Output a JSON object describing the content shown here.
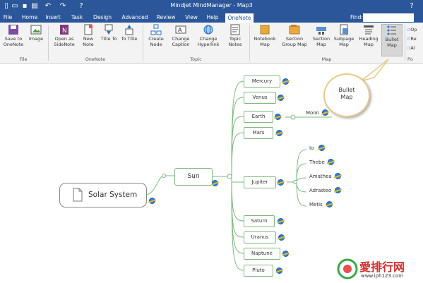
{
  "window": {
    "title": "Mindjet MindManager - Map3"
  },
  "quick_access": [
    "new-icon",
    "open-icon",
    "save-icon",
    "print-icon",
    "undo-icon",
    "redo-icon",
    "help-icon"
  ],
  "tabs": [
    {
      "label": "File"
    },
    {
      "label": "Home"
    },
    {
      "label": "Insert"
    },
    {
      "label": "Task"
    },
    {
      "label": "Design"
    },
    {
      "label": "Advanced"
    },
    {
      "label": "Review"
    },
    {
      "label": "View"
    },
    {
      "label": "Help"
    },
    {
      "label": "OneNote",
      "active": true
    }
  ],
  "find": {
    "label": "Find:",
    "value": ""
  },
  "ribbon": {
    "groups": [
      {
        "label": "File",
        "buttons": [
          {
            "label": "Save to OneNote"
          },
          {
            "label": "Image"
          }
        ]
      },
      {
        "label": "OneNote",
        "buttons": [
          {
            "label": "Open as SideNote"
          },
          {
            "label": "New Note"
          },
          {
            "label": "Title To"
          },
          {
            "label": "To Title"
          }
        ]
      },
      {
        "label": "Topic",
        "buttons": [
          {
            "label": "Create Node"
          },
          {
            "label": "Change Caption"
          },
          {
            "label": "Change Hyperlink"
          },
          {
            "label": "Topic Notes"
          }
        ]
      },
      {
        "label": "Map",
        "buttons": [
          {
            "label": "Notebook Map"
          },
          {
            "label": "Section Group Map"
          },
          {
            "label": "Section Map"
          },
          {
            "label": "Subpage Map"
          },
          {
            "label": "Heading Map"
          },
          {
            "label": "Bullet Map"
          }
        ]
      },
      {
        "label": "Po",
        "buttons": [
          {
            "label": "Op"
          },
          {
            "label": "Re"
          },
          {
            "label": "Al"
          }
        ]
      }
    ]
  },
  "callout": {
    "text": "Bullet Map"
  },
  "map": {
    "root": "Solar System",
    "sun": "Sun",
    "planets": [
      "Mercury",
      "Venus",
      "Earth",
      "Mars",
      "Jupiter",
      "Saturn",
      "Uranus",
      "Naptune",
      "Pluto"
    ],
    "moon": "Moon",
    "jupiter_moons": [
      "Io",
      "Thebe",
      "Amathea",
      "Adrasteo",
      "Metis"
    ]
  },
  "watermark": {
    "text": "愛排行网",
    "url": "www.iph123.com"
  },
  "colors": {
    "title_bar": "#2b579a",
    "branch_line": "#7fb77f",
    "node_border": "#7fb77f"
  }
}
